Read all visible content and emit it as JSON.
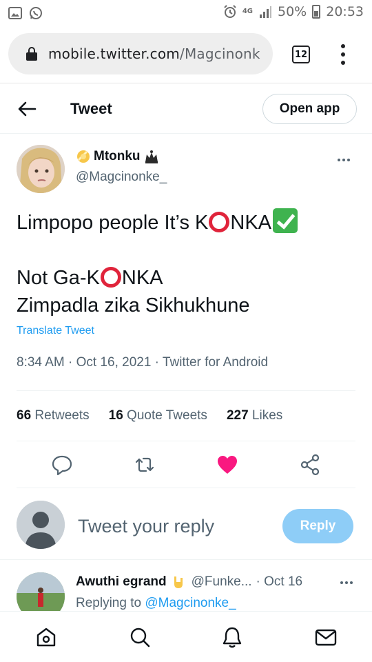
{
  "status_bar": {
    "network": "4G",
    "battery": "50%",
    "time": "20:53",
    "icons": [
      "image-icon",
      "whatsapp-icon",
      "alarm-icon",
      "signal-icon",
      "battery-icon"
    ]
  },
  "browser": {
    "url_host": "mobile.twitter.com",
    "url_path": "/Magcinonk",
    "tab_count": "12"
  },
  "header": {
    "title": "Tweet",
    "open_app": "Open app"
  },
  "tweet": {
    "author_name": "Mtonku",
    "author_handle": "@Magcinonke_",
    "line1_a": "Limpopo people It’s K",
    "line1_b": "NKA",
    "line3_a": "Not Ga-K",
    "line3_b": "NKA",
    "line4": "Zimpadla zika Sikhukhune",
    "translate": "Translate Tweet",
    "meta": "8:34 AM · Oct 16, 2021 · Twitter for Android",
    "stats": {
      "retweets_count": "66",
      "retweets_label": "Retweets",
      "quotes_count": "16",
      "quotes_label": "Quote Tweets",
      "likes_count": "227",
      "likes_label": "Likes"
    },
    "like_color": "#f91880"
  },
  "composer": {
    "placeholder": "Tweet your reply",
    "reply_label": "Reply"
  },
  "reply": {
    "name": "Awuthi egrand",
    "handle": "@Funke...",
    "time": "· Oct 16",
    "replying_prefix": "Replying to",
    "replying_to": "@Magcinonke_"
  },
  "nav": [
    "home-icon",
    "search-icon",
    "notifications-icon",
    "messages-icon"
  ],
  "colors": {
    "accent": "#1d9bf0",
    "reply_button": "#8ecdf7"
  }
}
